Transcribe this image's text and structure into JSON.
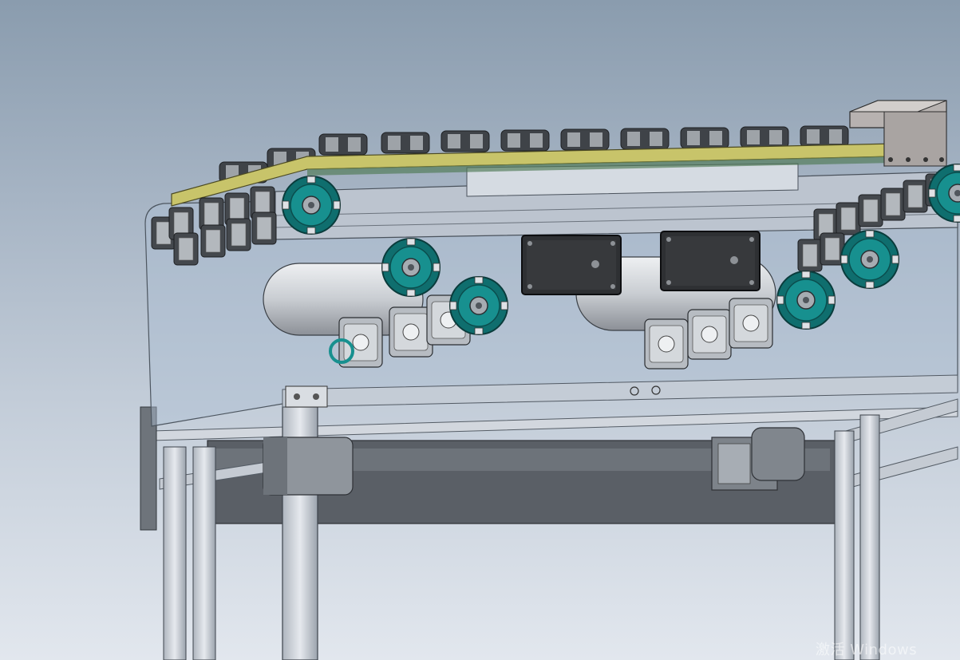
{
  "watermark": {
    "text": "激活 Windows"
  },
  "scene": {
    "chain_module_count": 11,
    "colors": {
      "background_top": "#8a9cae",
      "background_bottom": "#e2e7ee",
      "frame": "#c9ced6",
      "frame_edge": "#4c535c",
      "cover_plate": "#c8c46a",
      "chain_dark": "#3f4348",
      "chain_light": "#9ea3a8",
      "sprocket": "#127a7a",
      "roller": "#cfd3d8",
      "motor_block": "#2e3033",
      "glass": "#aebfd2"
    }
  }
}
